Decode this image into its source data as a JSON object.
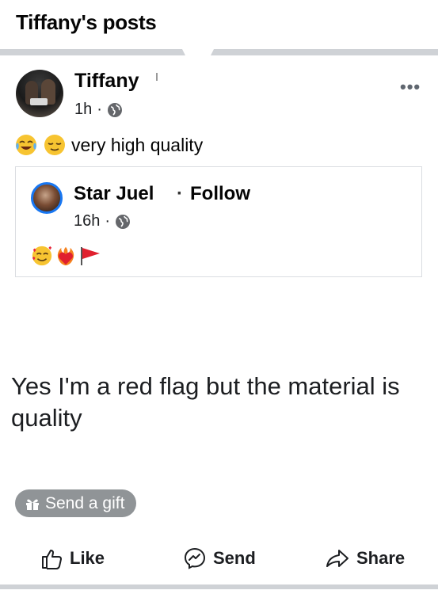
{
  "header": {
    "title": "Tiffany's posts"
  },
  "post": {
    "author": "Tiffany",
    "time": "1h",
    "meta_separator": "·",
    "privacy_icon": "globe-icon",
    "more_label": "•••",
    "text_emojis": [
      "face-with-tears-of-joy-emoji",
      "relieved-face-emoji"
    ],
    "text": "very high quality"
  },
  "shared_post": {
    "author": "Star Juel",
    "separator": "·",
    "follow_label": "Follow",
    "time": "16h",
    "meta_separator": "·",
    "privacy_icon": "globe-icon",
    "emojis": [
      "smiling-face-with-hearts-emoji",
      "heart-on-fire-emoji",
      "red-flag-emoji"
    ],
    "image_text": "Yes I'm a red flag but the material is quality"
  },
  "gift_button": {
    "label": "Send a gift",
    "icon": "gift-icon"
  },
  "actions": {
    "like": {
      "label": "Like",
      "icon": "thumbs-up-icon"
    },
    "send": {
      "label": "Send",
      "icon": "messenger-icon"
    },
    "share": {
      "label": "Share",
      "icon": "share-arrow-icon"
    }
  },
  "colors": {
    "follow_accent": "#1877f2",
    "gift_bg": "#909497",
    "divider": "#cfd2d6"
  }
}
